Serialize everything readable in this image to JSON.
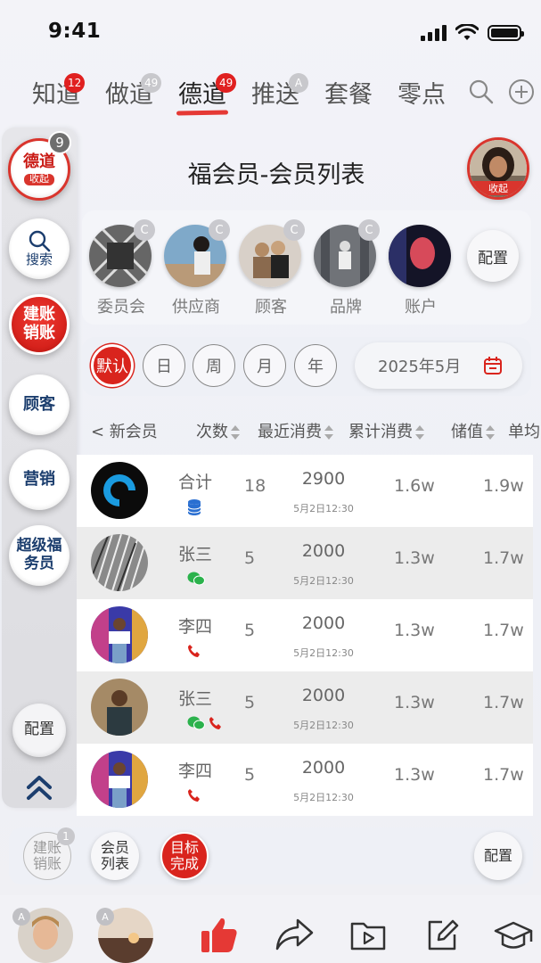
{
  "status": {
    "time": "9:41"
  },
  "tabs": [
    {
      "label": "知道",
      "badge": "12"
    },
    {
      "label": "做道",
      "badge": "49"
    },
    {
      "label": "德道",
      "badge": "49"
    },
    {
      "label": "推送",
      "badge": "A"
    },
    {
      "label": "套餐"
    },
    {
      "label": "零点"
    }
  ],
  "sidebar": {
    "main": {
      "label": "德道",
      "sub": "收起",
      "badge": "9"
    },
    "search": {
      "label": "搜索"
    },
    "account": {
      "label": "建账销账"
    },
    "customer": {
      "label": "顾客"
    },
    "marketing": {
      "label": "营销"
    },
    "super": {
      "label": "超级福务员"
    },
    "config": {
      "label": "配置"
    }
  },
  "header": {
    "title": "福会员-会员列表",
    "avatar_label": "收起"
  },
  "categories": [
    {
      "label": "委员会",
      "badge": "C"
    },
    {
      "label": "供应商",
      "badge": "C"
    },
    {
      "label": "顾客",
      "badge": "C"
    },
    {
      "label": "品牌",
      "badge": "C"
    },
    {
      "label": "账户"
    }
  ],
  "category_config": "配置",
  "filters": {
    "items": [
      "默认",
      "日",
      "周",
      "月",
      "年"
    ],
    "date": "2025年5月"
  },
  "table": {
    "headers": {
      "new_member": "< 新会员",
      "count": "次数",
      "recent": "最近消费",
      "total": "累计消费",
      "stored": "储值",
      "unit": "单均"
    },
    "rows": [
      {
        "name": "合计",
        "count": "18",
        "recent": "2900",
        "time": "5月2日12:30",
        "total": "1.6w",
        "stored": "1.9w",
        "icons": [
          "db"
        ]
      },
      {
        "name": "张三",
        "count": "5",
        "recent": "2000",
        "time": "5月2日12:30",
        "total": "1.3w",
        "stored": "1.7w",
        "icons": [
          "wechat"
        ]
      },
      {
        "name": "李四",
        "count": "5",
        "recent": "2000",
        "time": "5月2日12:30",
        "total": "1.3w",
        "stored": "1.7w",
        "icons": [
          "phone"
        ]
      },
      {
        "name": "张三",
        "count": "5",
        "recent": "2000",
        "time": "5月2日12:30",
        "total": "1.3w",
        "stored": "1.7w",
        "icons": [
          "wechat",
          "phone"
        ]
      },
      {
        "name": "李四",
        "count": "5",
        "recent": "2000",
        "time": "5月2日12:30",
        "total": "1.3w",
        "stored": "1.7w",
        "icons": [
          "phone"
        ]
      }
    ]
  },
  "action_bar": {
    "account": "建账销账",
    "account_badge": "1",
    "member_list": "会员列表",
    "goal": "目标完成",
    "config": "配置"
  },
  "bottom_nav": {
    "badge1": "A",
    "badge2": "A"
  },
  "colors": {
    "accent": "#d9241d",
    "nav_blue": "#1c3e6e"
  }
}
